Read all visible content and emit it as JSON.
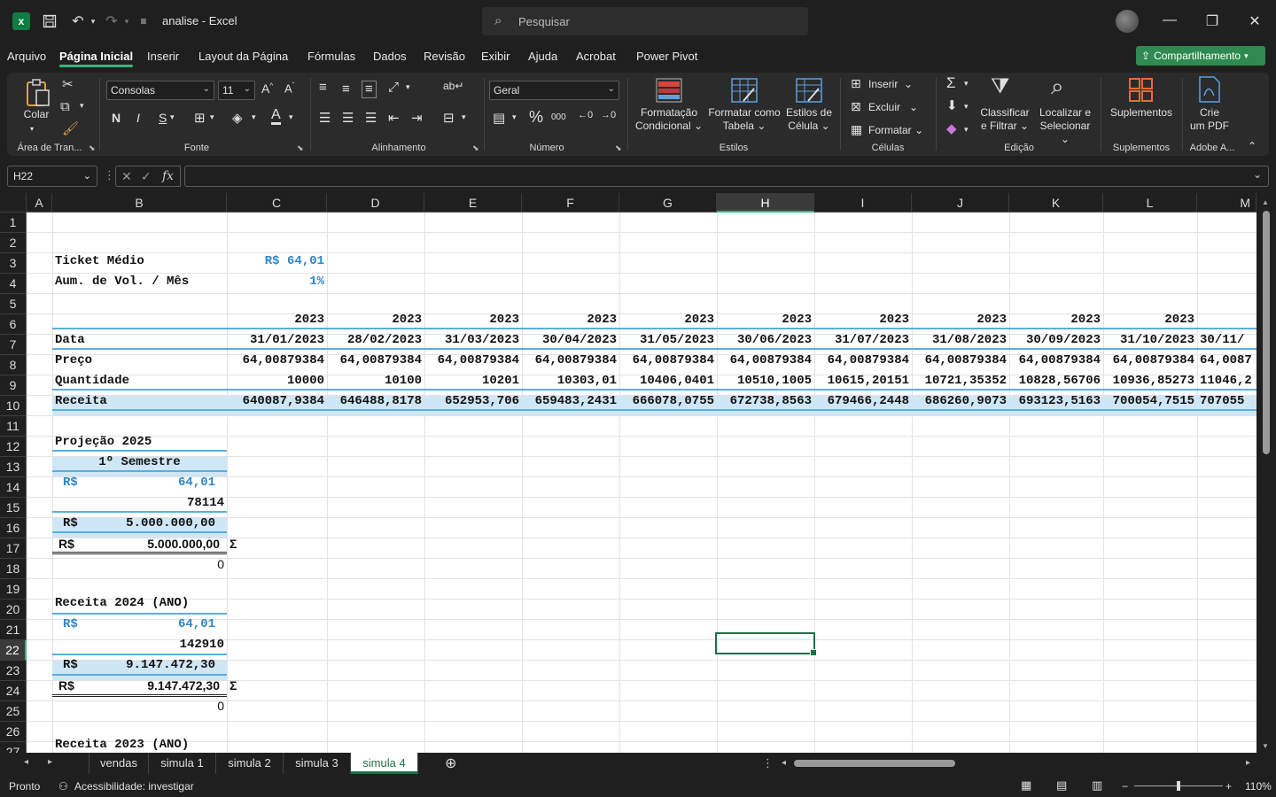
{
  "app": {
    "title": "analise  -  Excel",
    "search_placeholder": "Pesquisar",
    "share_label": "Compartilhamento"
  },
  "menu": [
    "Arquivo",
    "Página Inicial",
    "Inserir",
    "Layout da Página",
    "Fórmulas",
    "Dados",
    "Revisão",
    "Exibir",
    "Ajuda",
    "Acrobat",
    "Power Pivot"
  ],
  "ribbon": {
    "clipboard": {
      "paste": "Colar",
      "label": "Área de Tran..."
    },
    "font": {
      "name": "Consolas",
      "size": "11",
      "label": "Fonte",
      "bold": "N",
      "italic": "I",
      "underline": "S"
    },
    "alignment": {
      "label": "Alinhamento"
    },
    "number": {
      "format": "Geral",
      "label": "Número",
      "percent": "%",
      "thousands": "000"
    },
    "styles": {
      "cond": "Formatação\nCondicional",
      "cond1": "Formatação",
      "cond2": "Condicional",
      "table1": "Formatar como",
      "table2": "Tabela",
      "cell1": "Estilos de",
      "cell2": "Célula",
      "label": "Estilos"
    },
    "cells": {
      "insert": "Inserir",
      "delete": "Excluir",
      "format": "Formatar",
      "label": "Células"
    },
    "editing": {
      "sort1": "Classificar",
      "sort2": "e Filtrar",
      "find1": "Localizar e",
      "find2": "Selecionar",
      "label": "Edição"
    },
    "addins": {
      "name": "Suplementos",
      "label": "Suplementos"
    },
    "adobe": {
      "pdf1": "Crie",
      "pdf2": "um PDF",
      "label": "Adobe A..."
    }
  },
  "namebox": "H22",
  "columns": [
    "A",
    "B",
    "C",
    "D",
    "E",
    "F",
    "G",
    "H",
    "I",
    "J",
    "K",
    "L",
    "M"
  ],
  "rows": [
    "1",
    "2",
    "3",
    "4",
    "5",
    "6",
    "7",
    "8",
    "9",
    "10",
    "11",
    "12",
    "13",
    "14",
    "15",
    "16",
    "17",
    "18",
    "19",
    "20",
    "21",
    "22",
    "23",
    "24",
    "25",
    "26",
    "27"
  ],
  "sheet": {
    "ticket_label": "Ticket Médio",
    "ticket_value": "R$ 64,01",
    "vol_label": "Aum. de Vol. / Mês",
    "vol_value": "1%",
    "years": [
      "2023",
      "2023",
      "2023",
      "2023",
      "2023",
      "2023",
      "2023",
      "2023",
      "2023",
      "2023"
    ],
    "data_label": "Data",
    "dates": [
      "31/01/2023",
      "28/02/2023",
      "31/03/2023",
      "30/04/2023",
      "31/05/2023",
      "30/06/2023",
      "31/07/2023",
      "31/08/2023",
      "30/09/2023",
      "31/10/2023",
      "30/11/"
    ],
    "preco_label": "Preço",
    "precos": [
      "64,00879384",
      "64,00879384",
      "64,00879384",
      "64,00879384",
      "64,00879384",
      "64,00879384",
      "64,00879384",
      "64,00879384",
      "64,00879384",
      "64,00879384",
      "64,0087"
    ],
    "qtd_label": "Quantidade",
    "qtds": [
      "10000",
      "10100",
      "10201",
      "10303,01",
      "10406,0401",
      "10510,1005",
      "10615,20151",
      "10721,35352",
      "10828,56706",
      "10936,85273",
      "11046,2"
    ],
    "receita_label": "Receita",
    "receitas": [
      "640087,9384",
      "646488,8178",
      "652953,706",
      "659483,2431",
      "666078,0755",
      "672738,8563",
      "679466,2448",
      "686260,9073",
      "693123,5163",
      "700054,7515",
      "707055"
    ],
    "proj_title": "Projeção 2025",
    "semestre": "1º Semestre",
    "proj_price_cur": "R$",
    "proj_price": "64,01",
    "proj_qty": "78114",
    "proj_rev_cur": "R$",
    "proj_rev": "5.000.000,00",
    "proj_sum_cur": "R$",
    "proj_sum": "5.000.000,00",
    "sigma": "Σ",
    "proj_zero": "0",
    "r24_title": "Receita 2024 (ANO)",
    "r24_price_cur": "R$",
    "r24_price": "64,01",
    "r24_qty": "142910",
    "r24_rev_cur": "R$",
    "r24_rev": "9.147.472,30",
    "r24_sum_cur": "R$",
    "r24_sum": "9.147.472,30",
    "r24_zero": "0",
    "r23_title": "Receita 2023 (ANO)"
  },
  "tabs": [
    "vendas",
    "simula 1",
    "simula 2",
    "simula 3",
    "simula 4"
  ],
  "status": {
    "ready": "Pronto",
    "accessibility": "Acessibilidade: investigar",
    "zoom": "110%"
  },
  "colors": {
    "excel_green": "#1e7145",
    "accent_blue": "#2e86c9",
    "band_blue": "#cfe6f6"
  }
}
